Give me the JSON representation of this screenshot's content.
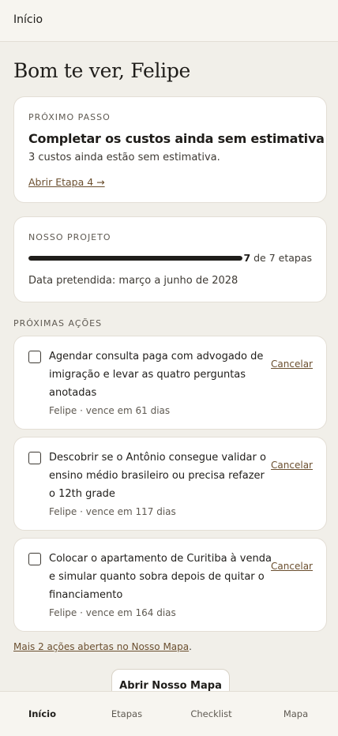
{
  "header": {
    "title": "Início"
  },
  "greeting": "Bom te ver, Felipe",
  "next_step": {
    "eyebrow": "PRÓXIMO PASSO",
    "title": "Completar os custos ainda sem estimativa",
    "subtitle": "3 custos ainda estão sem estimativa.",
    "link": "Abrir Etapa 4 →"
  },
  "project": {
    "eyebrow": "NOSSO PROJETO",
    "progress_current": "7",
    "progress_suffix": " de 7 etapas",
    "progress_fraction": 1.0,
    "date": "Data pretendida: março a junho de 2028"
  },
  "actions_section": {
    "label": "PRÓXIMAS AÇÕES",
    "cancel_label": "Cancelar",
    "items": [
      {
        "text": "Agendar consulta paga com advogado de imigração e levar as quatro perguntas anotadas",
        "meta": "Felipe · vence em 61 dias",
        "checked": false
      },
      {
        "text": "Descobrir se o Antônio consegue validar o ensino médio brasileiro ou precisa refazer o 12th grade",
        "meta": "Felipe · vence em 117 dias",
        "checked": false
      },
      {
        "text": "Colocar o apartamento de Curitiba à venda e simular quanto sobra depois de quitar o financiamento",
        "meta": "Felipe · vence em 164 dias",
        "checked": false
      }
    ]
  },
  "more_actions": {
    "link": "Mais 2 ações abertas no Nosso Mapa",
    "suffix": "."
  },
  "open_map_button": "Abrir Nosso Mapa",
  "bottom_nav": {
    "items": [
      {
        "label": "Início",
        "active": true
      },
      {
        "label": "Etapas",
        "active": false
      },
      {
        "label": "Checklist",
        "active": false
      },
      {
        "label": "Mapa",
        "active": false
      }
    ]
  }
}
